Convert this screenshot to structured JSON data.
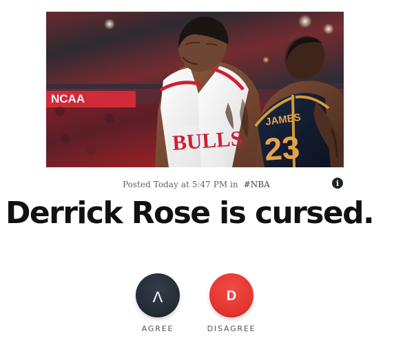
{
  "post": {
    "meta_prefix": "Posted Today at 5:47 PM in",
    "hashtag": "#NBA",
    "headline": "Derrick Rose is cursed.",
    "image": {
      "jersey_front": "BULLS",
      "jersey_back_name": "JAMES",
      "jersey_back_number": "23",
      "arena_banner": "NCAA"
    }
  },
  "controls": {
    "info_icon": "i",
    "agree": {
      "glyph": "Λ",
      "label": "AGREE"
    },
    "disagree": {
      "glyph": "D",
      "label": "DISAGREE"
    }
  },
  "colors": {
    "agree_button": "#2a313b",
    "disagree_button": "#e5342f",
    "headline": "#111111",
    "meta_text": "#5c6168"
  },
  "icons": {
    "info": "info-icon"
  }
}
